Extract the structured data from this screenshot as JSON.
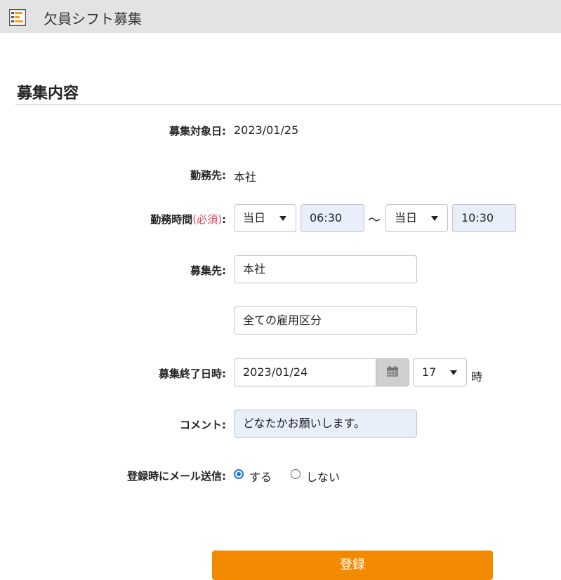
{
  "header": {
    "title": "欠員シフト募集"
  },
  "section": {
    "title": "募集内容"
  },
  "fields": {
    "target_date": {
      "label": "募集対象日:",
      "value": "2023/01/25"
    },
    "workplace": {
      "label": "勤務先:",
      "value": "本社"
    },
    "work_time": {
      "label": "勤務時間",
      "required": "(必須)",
      "colon": ":",
      "start_day": "当日",
      "start_time": "06:30",
      "separator": "～",
      "end_day": "当日",
      "end_time": "10:30"
    },
    "recruit_to": {
      "label": "募集先:",
      "location": "本社",
      "employment": "全ての雇用区分"
    },
    "end_datetime": {
      "label": "募集終了日時:",
      "date": "2023/01/24",
      "hour": "17",
      "hour_suffix": "時"
    },
    "comment": {
      "label": "コメント:",
      "value": "どなたかお願いします。"
    },
    "mail": {
      "label": "登録時にメール送信:",
      "option_yes": "する",
      "option_no": "しない",
      "selected": "する"
    }
  },
  "submit_label": "登録",
  "colors": {
    "accent": "#f28a00",
    "required": "#e0455e",
    "radio": "#1a73e8"
  }
}
